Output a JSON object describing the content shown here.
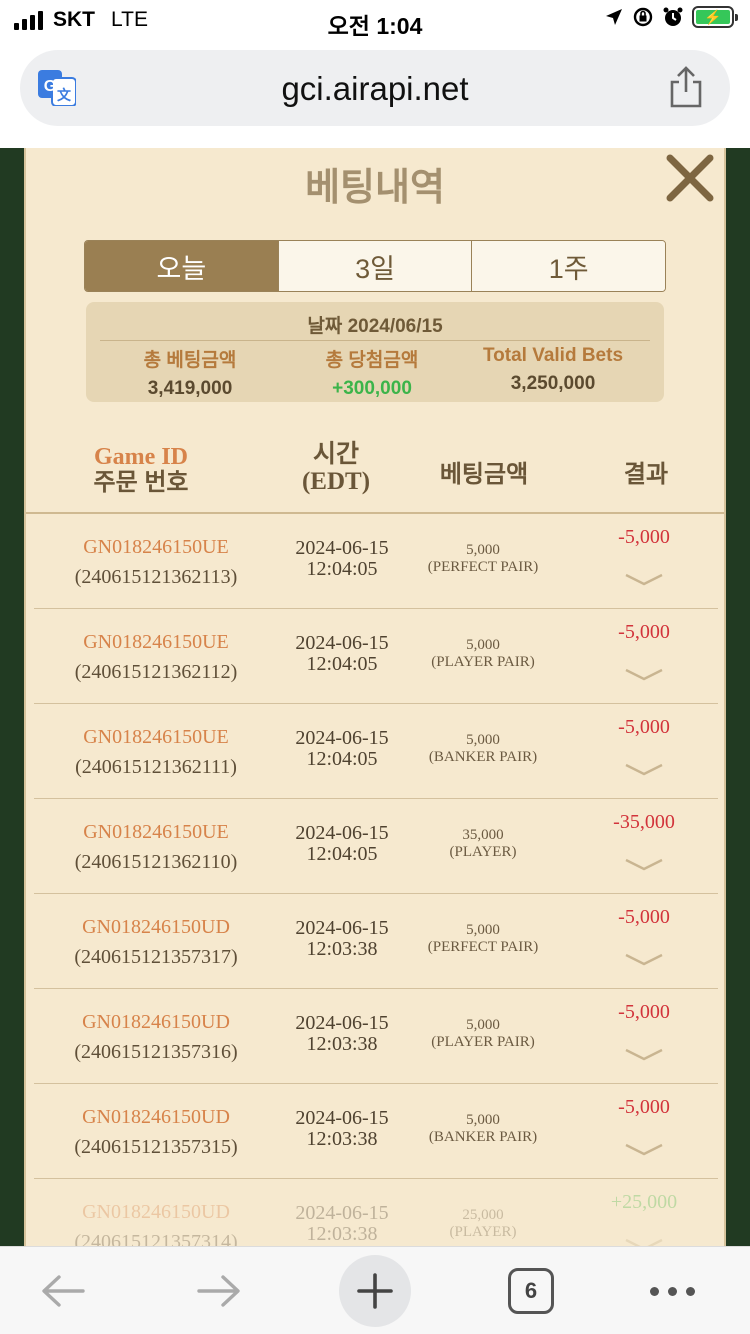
{
  "status_bar": {
    "carrier": "SKT",
    "network": "LTE",
    "time": "오전 1:04"
  },
  "browser": {
    "url": "gci.airapi.net",
    "tab_count": "6"
  },
  "modal": {
    "title": "베팅내역",
    "tabs": [
      {
        "label": "오늘",
        "active": true
      },
      {
        "label": "3일",
        "active": false
      },
      {
        "label": "1주",
        "active": false
      }
    ],
    "summary": {
      "date_label": "날짜  2024/06/15",
      "total_bet_label": "총 베팅금액",
      "total_bet_value": "3,419,000",
      "total_win_label": "총 당첨금액",
      "total_win_value": "+300,000",
      "valid_bets_label": "Total Valid Bets",
      "valid_bets_value": "3,250,000"
    },
    "columns": {
      "game_id": "Game ID",
      "order_no": "주문 번호",
      "time": "시간",
      "time_zone": "(EDT)",
      "amount": "베팅금액",
      "result": "결과"
    },
    "rows": [
      {
        "game_id": "GN018246150UE",
        "order": "(240615121362113)",
        "date": "2024-06-15",
        "time": "12:04:05",
        "amount": "5,000",
        "bet_type": "(PERFECT PAIR)",
        "result": "-5,000"
      },
      {
        "game_id": "GN018246150UE",
        "order": "(240615121362112)",
        "date": "2024-06-15",
        "time": "12:04:05",
        "amount": "5,000",
        "bet_type": "(PLAYER PAIR)",
        "result": "-5,000"
      },
      {
        "game_id": "GN018246150UE",
        "order": "(240615121362111)",
        "date": "2024-06-15",
        "time": "12:04:05",
        "amount": "5,000",
        "bet_type": "(BANKER PAIR)",
        "result": "-5,000"
      },
      {
        "game_id": "GN018246150UE",
        "order": "(240615121362110)",
        "date": "2024-06-15",
        "time": "12:04:05",
        "amount": "35,000",
        "bet_type": "(PLAYER)",
        "result": "-35,000"
      },
      {
        "game_id": "GN018246150UD",
        "order": "(240615121357317)",
        "date": "2024-06-15",
        "time": "12:03:38",
        "amount": "5,000",
        "bet_type": "(PERFECT PAIR)",
        "result": "-5,000"
      },
      {
        "game_id": "GN018246150UD",
        "order": "(240615121357316)",
        "date": "2024-06-15",
        "time": "12:03:38",
        "amount": "5,000",
        "bet_type": "(PLAYER PAIR)",
        "result": "-5,000"
      },
      {
        "game_id": "GN018246150UD",
        "order": "(240615121357315)",
        "date": "2024-06-15",
        "time": "12:03:38",
        "amount": "5,000",
        "bet_type": "(BANKER PAIR)",
        "result": "-5,000"
      },
      {
        "game_id": "GN018246150UD",
        "order": "(240615121357314)",
        "date": "2024-06-15",
        "time": "12:03:38",
        "amount": "25,000",
        "bet_type": "(PLAYER)",
        "result": "+25,000"
      }
    ]
  },
  "colors": {
    "modal_bg": "#f6e9cf",
    "accent": "#9a7f52",
    "loss": "#d2333b",
    "win": "#3cb44a",
    "game_id": "#d7834a"
  },
  "icons": {
    "translate": "translate-icon",
    "share": "share-icon",
    "close": "close-icon",
    "expand": "chevron-down-icon",
    "back": "arrow-left-icon",
    "forward": "arrow-right-icon",
    "new_tab": "plus-icon",
    "more": "more-dots-icon"
  }
}
